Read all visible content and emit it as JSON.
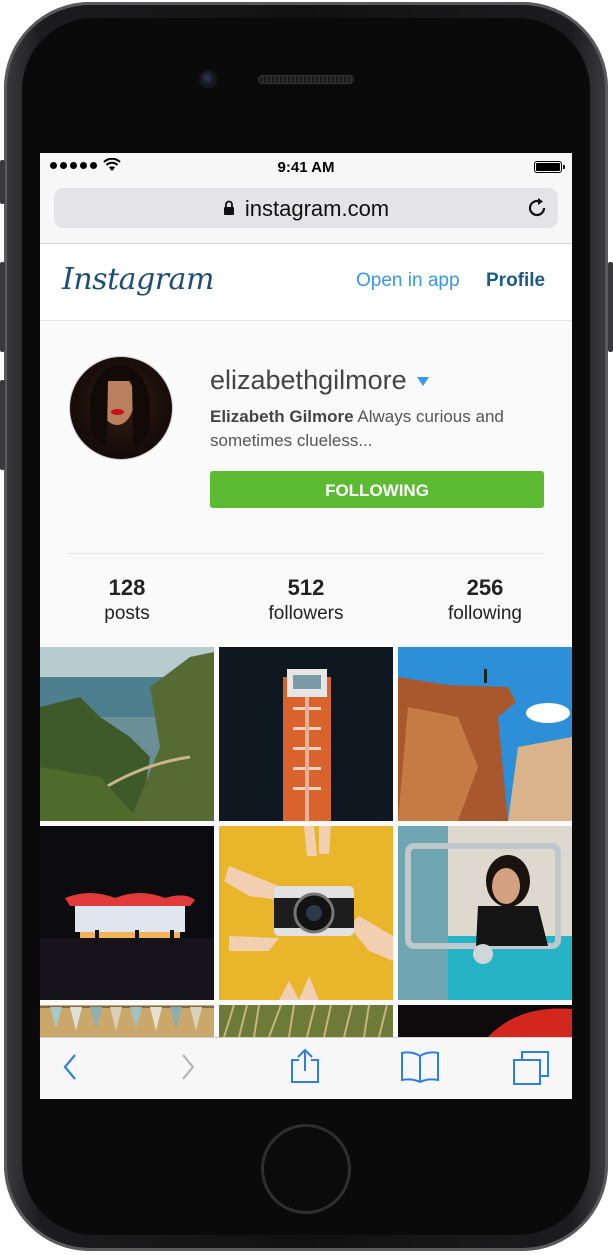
{
  "status_bar": {
    "time": "9:41 AM"
  },
  "browser": {
    "url": "instagram.com"
  },
  "header": {
    "logo": "Instagram",
    "open_in_app": "Open in app",
    "profile": "Profile"
  },
  "profile": {
    "username": "elizabethgilmore",
    "full_name": "Elizabeth Gilmore",
    "bio": "Always curious and sometimes clueless...",
    "follow_button": "FOLLOWING"
  },
  "stats": [
    {
      "value": "128",
      "label": "posts"
    },
    {
      "value": "512",
      "label": "followers"
    },
    {
      "value": "256",
      "label": "following"
    }
  ],
  "icons": [
    "lock-icon",
    "reload-icon",
    "back-icon",
    "forward-icon",
    "share-icon",
    "bookmarks-icon",
    "tabs-icon",
    "wifi-icon",
    "battery-icon",
    "caret-down-icon"
  ],
  "colors": {
    "accent_blue": "#3897f0",
    "following_green": "#5dbb33",
    "logo_blue": "#1d4e78"
  }
}
